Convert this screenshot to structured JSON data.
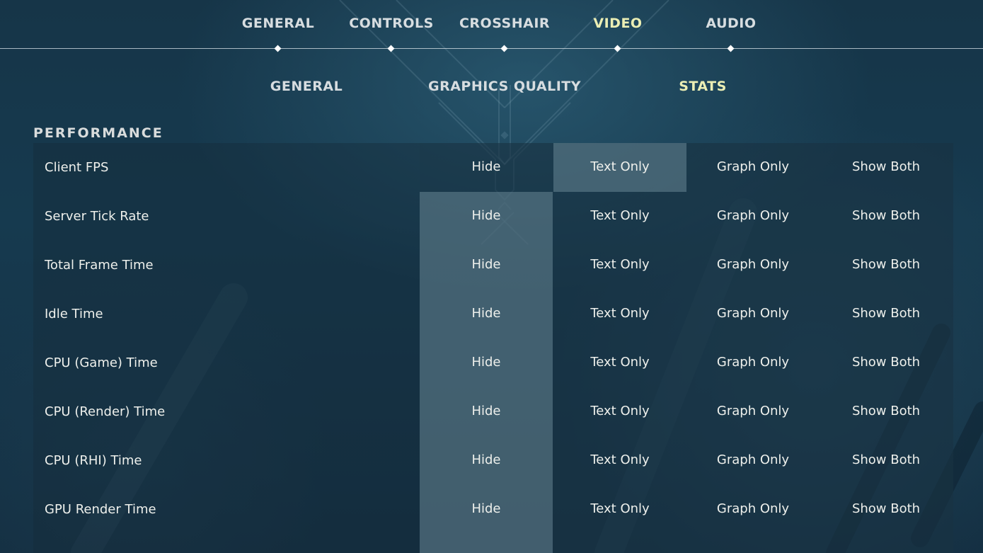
{
  "top_nav": {
    "tabs": [
      {
        "label": "GENERAL",
        "active": false
      },
      {
        "label": "CONTROLS",
        "active": false
      },
      {
        "label": "CROSSHAIR",
        "active": false
      },
      {
        "label": "VIDEO",
        "active": true
      },
      {
        "label": "AUDIO",
        "active": false
      }
    ]
  },
  "sub_nav": {
    "tabs": [
      {
        "label": "GENERAL",
        "active": false
      },
      {
        "label": "GRAPHICS QUALITY",
        "active": false
      },
      {
        "label": "STATS",
        "active": true
      }
    ]
  },
  "section": {
    "title": "PERFORMANCE"
  },
  "options": [
    "Hide",
    "Text Only",
    "Graph Only",
    "Show Both"
  ],
  "rows": [
    {
      "label": "Client FPS",
      "selected": "Text Only"
    },
    {
      "label": "Server Tick Rate",
      "selected": "Hide"
    },
    {
      "label": "Total Frame Time",
      "selected": "Hide"
    },
    {
      "label": "Idle Time",
      "selected": "Hide"
    },
    {
      "label": "CPU (Game) Time",
      "selected": "Hide"
    },
    {
      "label": "CPU (Render) Time",
      "selected": "Hide"
    },
    {
      "label": "CPU (RHI) Time",
      "selected": "Hide"
    },
    {
      "label": "GPU Render Time",
      "selected": "Hide"
    }
  ],
  "colors": {
    "active_tab": "#ebeeb4",
    "inactive_tab": "#d7dde0",
    "selected_option_bg": "#78969f"
  }
}
